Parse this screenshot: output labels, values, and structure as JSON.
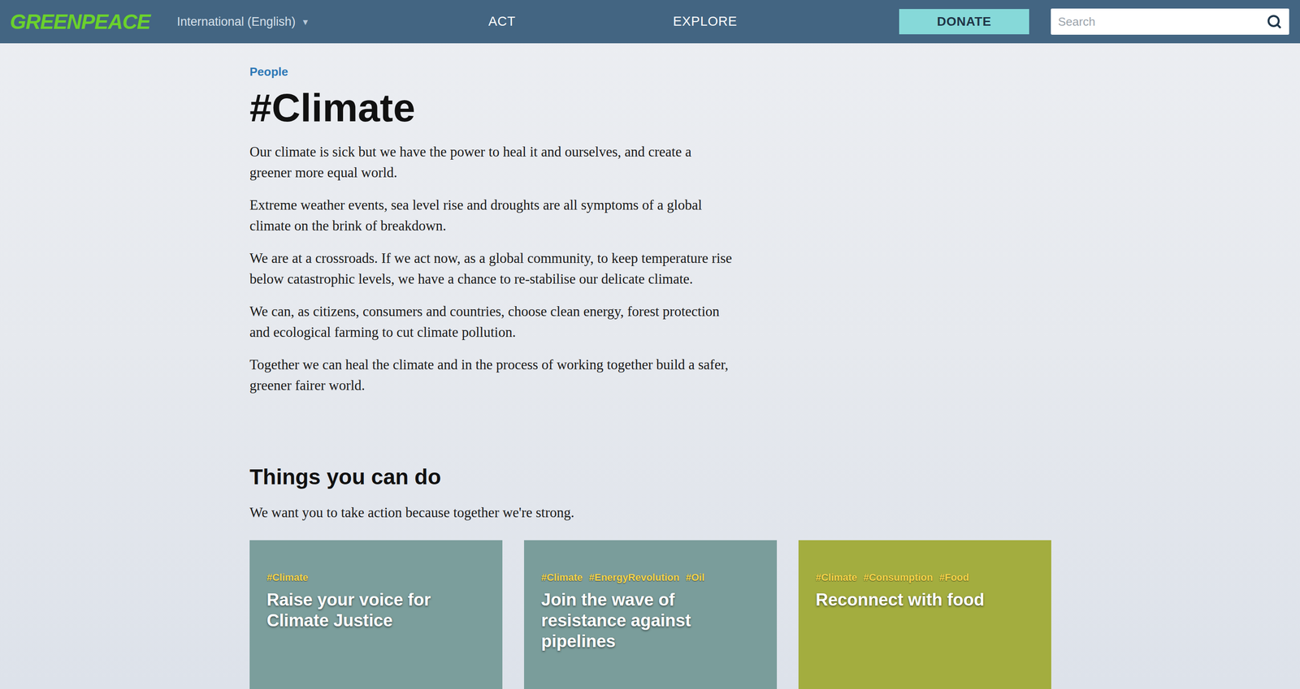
{
  "header": {
    "logo": "GREENPEACE",
    "language": "International (English)",
    "language_arrow": "▾",
    "nav": [
      "ACT",
      "EXPLORE"
    ],
    "donate": "DONATE",
    "search": {
      "placeholder": "Search"
    }
  },
  "page": {
    "category": "People",
    "title": "#Climate",
    "paragraphs": [
      "Our climate is sick but we have the power to heal it and ourselves, and create a greener more equal world.",
      "Extreme weather events, sea level rise and droughts are all symptoms of a global climate on the brink of breakdown.",
      "We are at a crossroads. If we act now, as a global community, to keep temperature rise below catastrophic levels, we have a chance to re-stabilise our delicate climate.",
      "We can, as citizens, consumers and countries, choose clean energy, forest protection and ecological farming to cut climate pollution.",
      "Together we can heal the climate and in the process of working together build a safer, greener fairer world."
    ]
  },
  "actions": {
    "title": "Things you can do",
    "subtitle": "We want you to take action because together we're strong.",
    "cards": [
      {
        "tags": [
          "#Climate"
        ],
        "title": "Raise your voice for Climate Justice",
        "color": "#7b9e9c"
      },
      {
        "tags": [
          "#Climate",
          "#EnergyRevolution",
          "#Oil"
        ],
        "title": "Join the wave of resistance against pipelines",
        "color": "#7a9d9b"
      },
      {
        "tags": [
          "#Climate",
          "#Consumption",
          "#Food"
        ],
        "title": "Reconnect with food",
        "color": "#a3ad3f"
      }
    ]
  }
}
